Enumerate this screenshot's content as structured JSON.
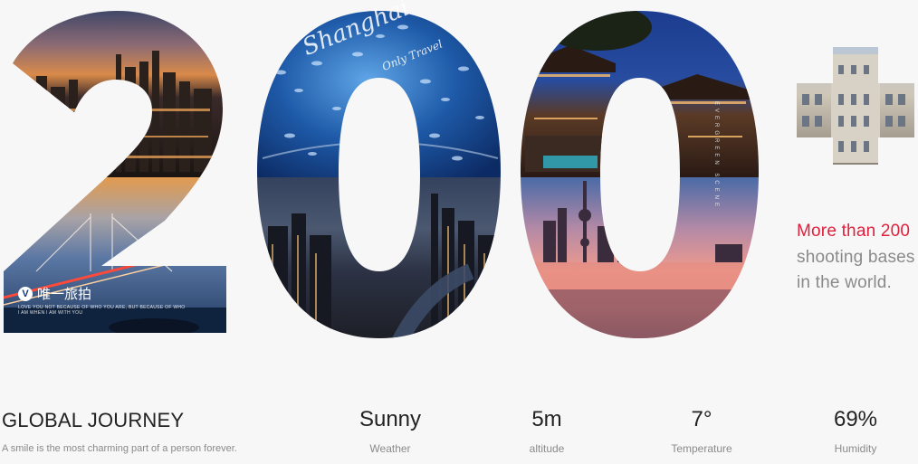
{
  "hero": {
    "number": "200",
    "script_title": "Shanghai",
    "script_sub": "Only Travel",
    "vertical_caption": "EVERGREEN SCENE",
    "brand_mark": "V",
    "brand_name": "唯一旅拍",
    "brand_tagline_1": "LOVE YOU NOT BECAUSE OF WHO YOU ARE, BUT BECAUSE OF WHO",
    "brand_tagline_2": "I AM WHEN I AM WITH YOU"
  },
  "side": {
    "accent": "More than 200",
    "rest": "shooting bases in the world."
  },
  "footer": {
    "title": "GLOBAL JOURNEY",
    "subtitle": "A smile is the most charming part of a person forever.",
    "stats": [
      {
        "value": "Sunny",
        "label": "Weather"
      },
      {
        "value": "5m",
        "label": "altitude"
      },
      {
        "value": "7°",
        "label": "Temperature"
      },
      {
        "value": "69%",
        "label": "Humidity"
      }
    ]
  },
  "colors": {
    "accent": "#e0213c",
    "muted": "#8a8a8a",
    "ink": "#222222",
    "background": "#f7f7f8"
  }
}
